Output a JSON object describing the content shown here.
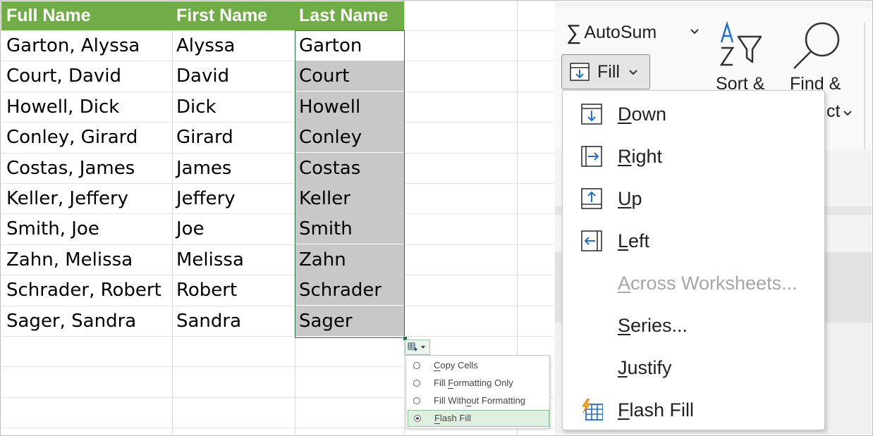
{
  "sheet": {
    "headers": [
      "Full Name",
      "First Name",
      "Last Name"
    ],
    "rows": [
      [
        "Garton, Alyssa",
        "Alyssa",
        "Garton"
      ],
      [
        "Court, David",
        "David",
        "Court"
      ],
      [
        "Howell, Dick",
        "Dick",
        "Howell"
      ],
      [
        "Conley, Girard",
        "Girard",
        "Conley"
      ],
      [
        "Costas, James",
        "James",
        "Costas"
      ],
      [
        "Keller, Jeffery",
        "Jeffery",
        "Keller"
      ],
      [
        "Smith, Joe",
        "Joe",
        "Smith"
      ],
      [
        "Zahn, Melissa",
        "Melissa",
        "Zahn"
      ],
      [
        "Schrader, Robert",
        "Robert",
        "Schrader"
      ],
      [
        "Sager, Sandra",
        "Sandra",
        "Sager"
      ]
    ],
    "header_color": "#70ad47",
    "selection_color": "#217346"
  },
  "autofill_options": {
    "items": [
      {
        "pre": "",
        "u": "C",
        "post": "opy Cells",
        "selected": false
      },
      {
        "pre": "Fill ",
        "u": "F",
        "post": "ormatting Only",
        "selected": false
      },
      {
        "pre": "Fill With",
        "u": "o",
        "post": "ut Formatting",
        "selected": false
      },
      {
        "pre": "",
        "u": "F",
        "post": "lash Fill",
        "selected": true
      }
    ]
  },
  "ribbon": {
    "autosum_label": "AutoSum",
    "fill_label": "Fill",
    "sort_label": "Sort &",
    "find_label": "Find &",
    "select_partial": "ct"
  },
  "fill_menu": {
    "items": [
      {
        "pre": "",
        "u": "D",
        "post": "own",
        "icon": "fill-down-icon",
        "disabled": false
      },
      {
        "pre": "",
        "u": "R",
        "post": "ight",
        "icon": "fill-right-icon",
        "disabled": false
      },
      {
        "pre": "",
        "u": "U",
        "post": "p",
        "icon": "fill-up-icon",
        "disabled": false
      },
      {
        "pre": "",
        "u": "L",
        "post": "eft",
        "icon": "fill-left-icon",
        "disabled": false
      },
      {
        "pre": "",
        "u": "A",
        "post": "cross Worksheets...",
        "icon": "",
        "disabled": true
      },
      {
        "pre": "",
        "u": "S",
        "post": "eries...",
        "icon": "",
        "disabled": false
      },
      {
        "pre": "",
        "u": "J",
        "post": "ustify",
        "icon": "",
        "disabled": false
      },
      {
        "pre": "",
        "u": "F",
        "post": "lash Fill",
        "icon": "flash-fill-icon",
        "disabled": false
      }
    ]
  }
}
